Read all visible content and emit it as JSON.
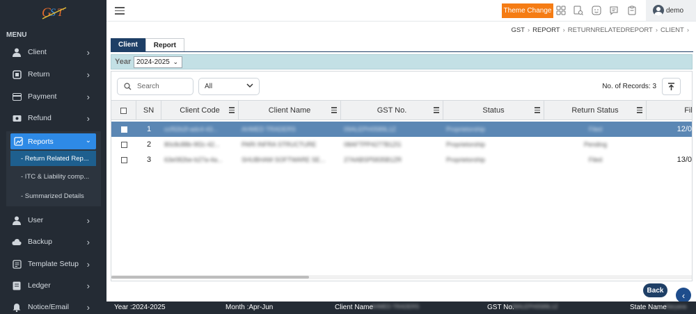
{
  "logo_text": "GST",
  "sidebar": {
    "menu_title": "MENU",
    "items": [
      {
        "label": "Client"
      },
      {
        "label": "Return"
      },
      {
        "label": "Payment"
      },
      {
        "label": "Refund"
      },
      {
        "label": "Reports"
      },
      {
        "label": "User"
      },
      {
        "label": "Backup"
      },
      {
        "label": "Template Setup"
      },
      {
        "label": "Ledger"
      },
      {
        "label": "Notice/Email"
      }
    ],
    "sub_items": [
      {
        "label": "- Return Related Rep..."
      },
      {
        "label": "- ITC & Liability comp..."
      },
      {
        "label": "- Summarized Details"
      }
    ]
  },
  "header": {
    "theme_button": "Theme Change",
    "user": "demo"
  },
  "breadcrumb": [
    "GST",
    "REPORT",
    "RETURNRELATEDREPORT",
    "CLIENT"
  ],
  "tabs": [
    {
      "label": "Client"
    },
    {
      "label": "Report"
    }
  ],
  "year_bar": {
    "label": "Year",
    "value": "2024-2025"
  },
  "toolbar": {
    "search_placeholder": "Search",
    "filter_value": "All",
    "records_text": "No. of Records: 3"
  },
  "table": {
    "columns": [
      "SN",
      "Client Code",
      "Client Name",
      "GST No.",
      "Status",
      "Return Status",
      "Fil"
    ],
    "rows": [
      {
        "sn": "1",
        "code": "ccf92b2f-adc4-43...",
        "name": "AHMED TRADERS",
        "gst": "09ALEPH0589L1Z",
        "status": "Proprietorship",
        "return_status": "Filed",
        "filed": "12/0"
      },
      {
        "sn": "2",
        "code": "80c8c88b-9f2c-42...",
        "name": "PARI INFRA STRUCTURE",
        "gst": "08AFTPP4277B1ZG",
        "status": "Proprietorship",
        "return_status": "Pending",
        "filed": ""
      },
      {
        "sn": "3",
        "code": "63e082be-b27a-4a...",
        "name": "SHUBHAM SOFTWARE SE...",
        "gst": "27AABSP5835B1ZR",
        "status": "Proprietorship",
        "return_status": "Filed",
        "filed": "13/0"
      }
    ]
  },
  "back_button": "Back",
  "footer": {
    "year": "Year :2024-2025",
    "month": "Month :Apr-Jun",
    "client_label": "Client Name",
    "client_value": "AHMED TRADERS",
    "gst_label": "GST No.",
    "gst_value": "09ALEPH0589L1Z",
    "state_label": "State Name",
    "state_value": "Haryana"
  },
  "colors": {
    "accent": "#2e8ae6",
    "theme_button": "#f57c14",
    "navy": "#1e3f66",
    "selected_row": "#5b87b4"
  }
}
